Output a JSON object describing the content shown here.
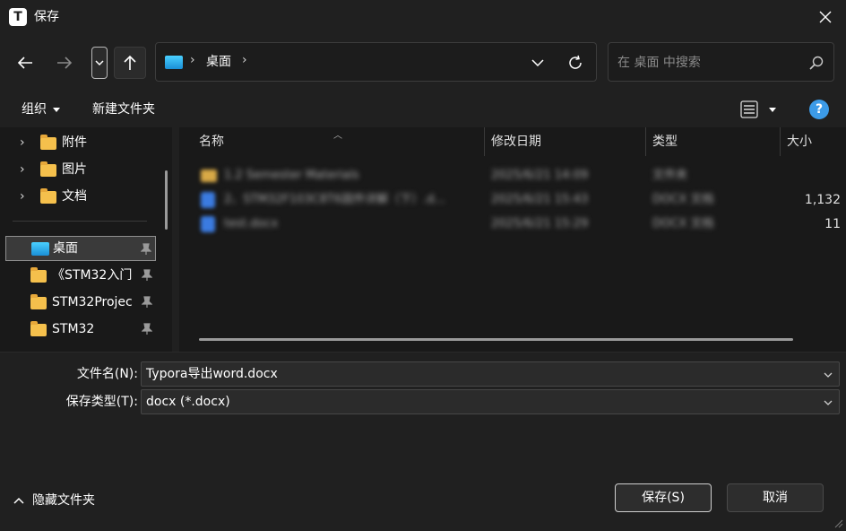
{
  "window": {
    "app_logo_letter": "T",
    "title": "保存"
  },
  "navigation": {
    "address_location": "桌面",
    "search_placeholder": "在 桌面 中搜索"
  },
  "toolbar": {
    "organize_label": "组织",
    "new_folder_label": "新建文件夹",
    "help_glyph": "?"
  },
  "sidebar": {
    "tree_items": [
      {
        "label": "附件"
      },
      {
        "label": "图片"
      },
      {
        "label": "文档"
      }
    ],
    "quick_access": [
      {
        "label": "桌面",
        "selected": true
      },
      {
        "label": "《STM32入门"
      },
      {
        "label": "STM32Projec"
      },
      {
        "label": "STM32"
      }
    ]
  },
  "file_list": {
    "columns": [
      "名称",
      "修改日期",
      "类型",
      "大小"
    ],
    "rows": [
      {
        "name": "1.2 Semester Materials",
        "date": "2025/6/21 14:09",
        "type": "文件夹",
        "size": "",
        "kind": "folder"
      },
      {
        "name": "2、STM32F103C8T6固件详解（下）.d...",
        "date": "2025/6/21 15:43",
        "type": "DOCX 文档",
        "size": "1,132",
        "kind": "docx"
      },
      {
        "name": "test.docx",
        "date": "2025/6/21 15:29",
        "type": "DOCX 文档",
        "size": "11",
        "kind": "docx"
      }
    ]
  },
  "save_form": {
    "filename_label": "文件名(N):",
    "filename_value": "Typora导出word.docx",
    "filetype_label": "保存类型(T):",
    "filetype_value": "docx (*.docx)"
  },
  "footer": {
    "hide_folders_label": "隐藏文件夹",
    "save_button": "保存(S)",
    "cancel_button": "取消"
  },
  "colors": {
    "background": "#202020",
    "pane": "#191919",
    "accent_help": "#3c9be8",
    "folder": "#f5c04c"
  }
}
